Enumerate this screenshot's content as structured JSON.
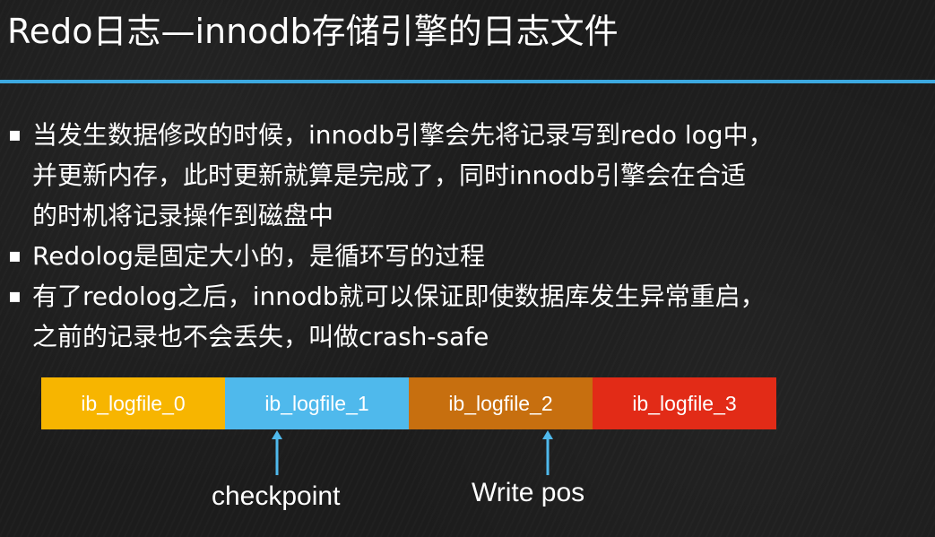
{
  "title": "Redo日志—innodb存储引擎的日志文件",
  "bullets": [
    {
      "lines": [
        "当发生数据修改的时候，innodb引擎会先将记录写到redo log中，",
        "并更新内存，此时更新就算是完成了，同时innodb引擎会在合适",
        "的时机将记录操作到磁盘中"
      ]
    },
    {
      "lines": [
        "Redolog是固定大小的，是循环写的过程"
      ]
    },
    {
      "lines": [
        "有了redolog之后，innodb就可以保证即使数据库发生异常重启，",
        "之前的记录也不会丢失，叫做crash-safe"
      ]
    }
  ],
  "bullet_marker": "▪",
  "files": [
    {
      "label": "ib_logfile_0",
      "color": "#f7b500"
    },
    {
      "label": "ib_logfile_1",
      "color": "#4fb9ec"
    },
    {
      "label": "ib_logfile_2",
      "color": "#c76f0f"
    },
    {
      "label": "ib_logfile_3",
      "color": "#e22b17"
    }
  ],
  "pointers": {
    "checkpoint": "checkpoint",
    "write_pos": "Write pos"
  },
  "colors": {
    "rule": "#3da9e0",
    "arrow": "#4fb9ec",
    "background": "#1c1c1c"
  }
}
